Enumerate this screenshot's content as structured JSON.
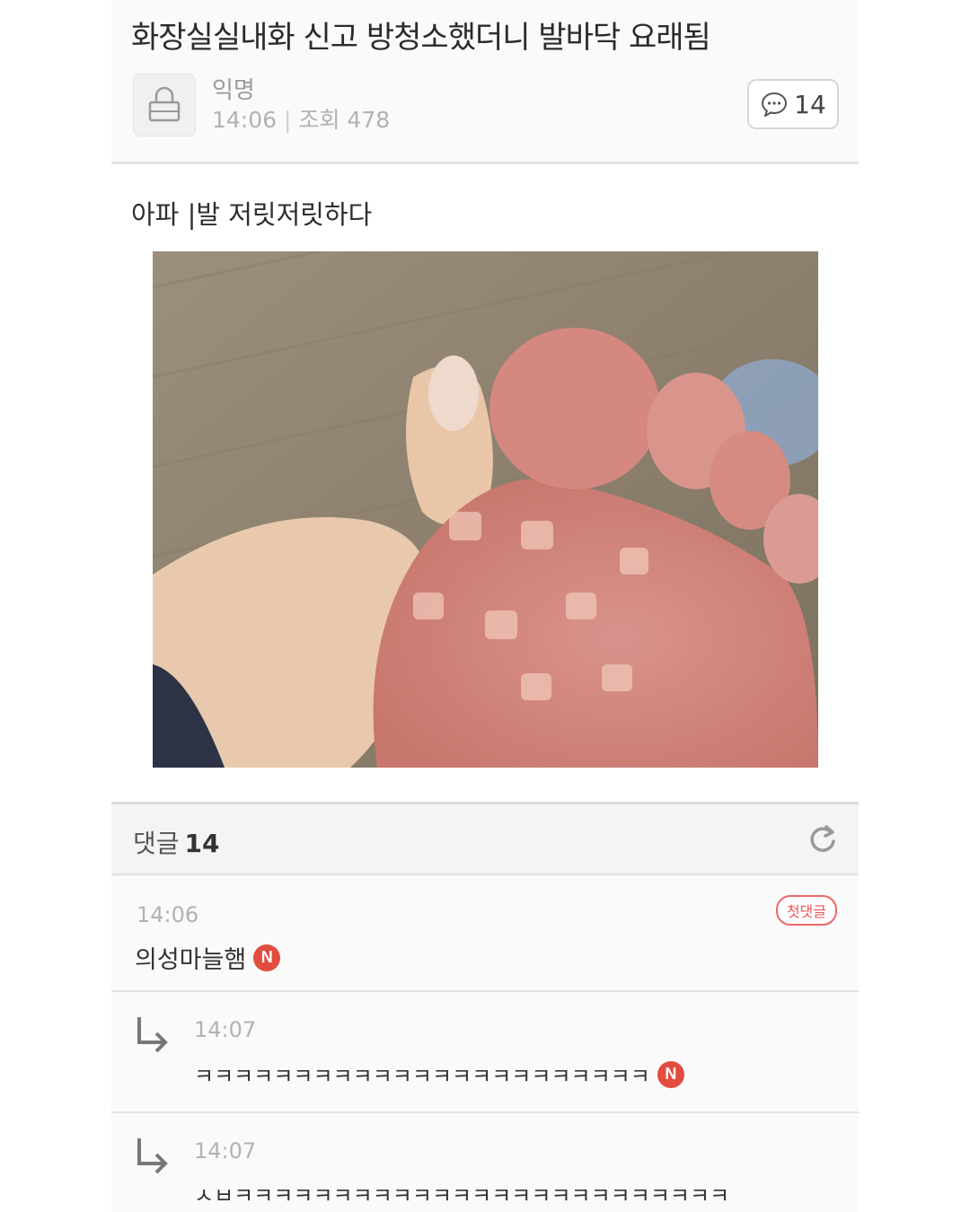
{
  "post": {
    "title": "화장실실내화 신고 방청소했더니 발바닥 요래됨",
    "author": "익명",
    "time": "14:06",
    "views_label": "조회 478",
    "comment_count": "14",
    "body": "아파  |발 저릿저릿하다"
  },
  "comments_header": {
    "label": "댓글",
    "count": "14"
  },
  "comments": [
    {
      "time": "14:06",
      "text": "의성마늘햄",
      "new_badge": "N",
      "first_badge": "첫댓글"
    },
    {
      "time": "14:07",
      "text": "ㅋㅋㅋㅋㅋㅋㅋㅋㅋㅋㅋㅋㅋㅋㅋㅋㅋㅋㅋㅋㅋㅋㅋ",
      "new_badge": "N"
    },
    {
      "time": "14:07",
      "text": "ㅅㅂㅋㅋㅋㅋㅋㅋㅋㅋㅋㅋㅋㅋㅋㅋㅋㅋㅋㅋㅋㅋㅋㅋㅋㅋㅋ"
    }
  ],
  "icons": {
    "avatar": "lock-icon",
    "comment_button": "speech-bubble-icon",
    "refresh": "refresh-icon",
    "reply": "reply-arrow-icon",
    "new": "new-badge-icon"
  },
  "colors": {
    "badge_red": "#e24c3f",
    "panel_bg": "#fafafa"
  }
}
